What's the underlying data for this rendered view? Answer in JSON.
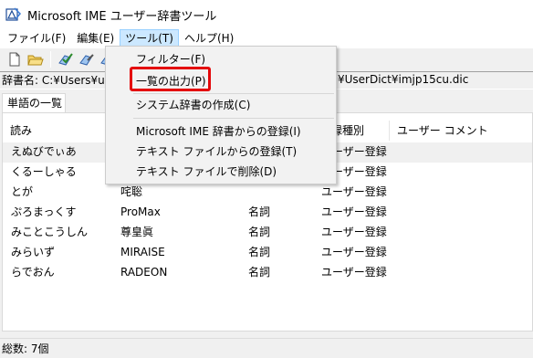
{
  "window": {
    "title": "Microsoft IME ユーザー辞書ツール"
  },
  "menubar": {
    "items": [
      {
        "label": "ファイル(F)",
        "active": false
      },
      {
        "label": "編集(E)",
        "active": false
      },
      {
        "label": "ツール(T)",
        "active": true
      },
      {
        "label": "ヘルプ(H)",
        "active": false
      }
    ]
  },
  "toolbar": {
    "icons": [
      "new-file-icon",
      "open-folder-icon",
      "check-icon",
      "edit-icon",
      "delete-icon"
    ]
  },
  "dictname": {
    "prefix": "辞書名: C:¥Users¥user",
    "suffix": "¥UserDict¥imjp15cu.dic"
  },
  "tabs": [
    {
      "label": "単語の一覧"
    }
  ],
  "table": {
    "columns": [
      "読み",
      "",
      "",
      "登録種別",
      "ユーザー コメント"
    ],
    "rows": [
      {
        "reading": "えぬびでぃあ",
        "word": "",
        "pos": "",
        "type": "ユーザー登録",
        "comment": ""
      },
      {
        "reading": "くるーしゃる",
        "word": "",
        "pos": "",
        "type": "ユーザー登録",
        "comment": ""
      },
      {
        "reading": "とが",
        "word": "咤聡",
        "pos": "",
        "type": "ユーザー登録",
        "comment": ""
      },
      {
        "reading": "ぷろまっくす",
        "word": "ProMax",
        "pos": "名詞",
        "type": "ユーザー登録",
        "comment": ""
      },
      {
        "reading": "みことこうしん",
        "word": "尊皇眞",
        "pos": "名詞",
        "type": "ユーザー登録",
        "comment": ""
      },
      {
        "reading": "みらいず",
        "word": "MIRAISE",
        "pos": "名詞",
        "type": "ユーザー登録",
        "comment": ""
      },
      {
        "reading": "らでおん",
        "word": "RADEON",
        "pos": "名詞",
        "type": "ユーザー登録",
        "comment": ""
      }
    ]
  },
  "status": {
    "total": "総数: 7個"
  },
  "dropdown": {
    "items": [
      {
        "label": "フィルター(F)"
      },
      {
        "label": "一覧の出力(P)"
      },
      {
        "label": "システム辞書の作成(C)"
      },
      {
        "label": "Microsoft IME 辞書からの登録(I)"
      },
      {
        "label": "テキスト ファイルからの登録(T)"
      },
      {
        "label": "テキスト ファイルで削除(D)"
      }
    ]
  },
  "colors": {
    "highlight": "#e4080a",
    "menu_active": "#cce8ff"
  }
}
